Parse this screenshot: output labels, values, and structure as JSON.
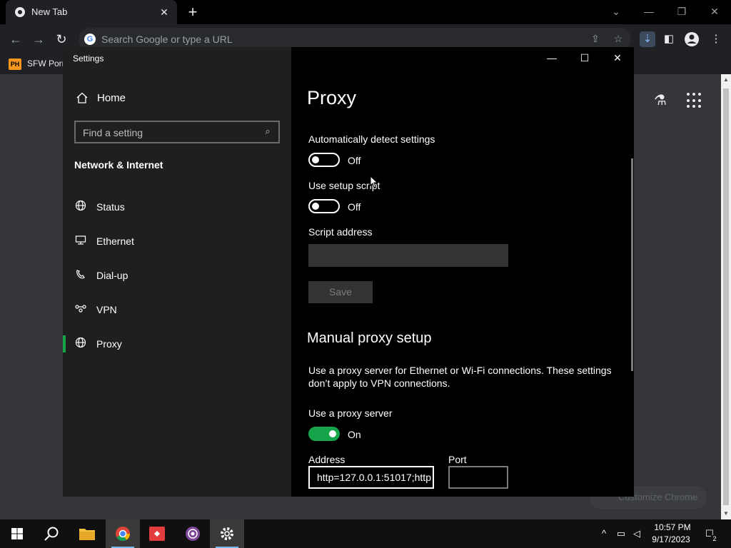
{
  "chrome": {
    "tab_title": "New Tab",
    "omnibox_placeholder": "Search Google or type a URL",
    "bookmark": {
      "icon_text": "PH",
      "label": "SFW Porn"
    },
    "customize_label": "Customize Chrome"
  },
  "settings": {
    "window_title": "Settings",
    "home_label": "Home",
    "search_placeholder": "Find a setting",
    "section_label": "Network & Internet",
    "nav_items": [
      {
        "label": "Status",
        "icon": "globe-icon"
      },
      {
        "label": "Ethernet",
        "icon": "ethernet-icon"
      },
      {
        "label": "Dial-up",
        "icon": "dialup-icon"
      },
      {
        "label": "VPN",
        "icon": "vpn-icon"
      },
      {
        "label": "Proxy",
        "icon": "globe-icon",
        "selected": true
      }
    ],
    "page_title": "Proxy",
    "auto_detect": {
      "label": "Automatically detect settings",
      "state": "Off",
      "on": false
    },
    "setup_script": {
      "label": "Use setup script",
      "state": "Off",
      "on": false
    },
    "script_address": {
      "label": "Script address",
      "value": ""
    },
    "save_label": "Save",
    "manual_title": "Manual proxy setup",
    "manual_desc": "Use a proxy server for Ethernet or Wi-Fi connections. These settings don’t apply to VPN connections.",
    "use_proxy": {
      "label": "Use a proxy server",
      "state": "On",
      "on": true
    },
    "address": {
      "label": "Address",
      "value": "http=127.0.0.1:51017;http"
    },
    "port": {
      "label": "Port",
      "value": ""
    }
  },
  "taskbar": {
    "time": "10:57 PM",
    "date": "9/17/2023",
    "notification_count": "2"
  },
  "colors": {
    "accent_green": "#16a34a",
    "taskbar_active": "#3a3a3a"
  }
}
